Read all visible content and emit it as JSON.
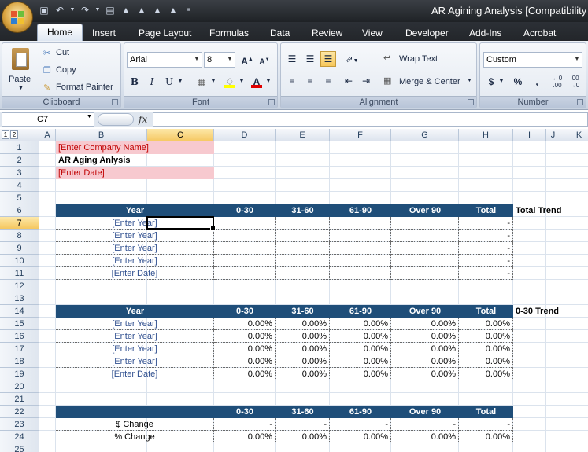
{
  "window": {
    "title": "AR Agining Analysis  [Compatibility"
  },
  "ribbon_tabs": [
    "Home",
    "Insert",
    "Page Layout",
    "Formulas",
    "Data",
    "Review",
    "View",
    "Developer",
    "Add-Ins",
    "Acrobat"
  ],
  "clipboard": {
    "paste": "Paste",
    "cut": "Cut",
    "copy": "Copy",
    "format_painter": "Format Painter",
    "label": "Clipboard"
  },
  "font": {
    "name": "Arial",
    "size": "8",
    "label": "Font",
    "bold": "B",
    "italic": "I",
    "underline": "U"
  },
  "alignment": {
    "wrap": "Wrap Text",
    "merge": "Merge & Center",
    "label": "Alignment"
  },
  "number": {
    "format": "Custom",
    "currency": "$",
    "percent": "%",
    "comma": ",",
    "label": "Number"
  },
  "formula_bar": {
    "name_box": "C7",
    "fx": "fx",
    "value": ""
  },
  "outline_levels": [
    "1",
    "2"
  ],
  "columns": [
    "A",
    "B",
    "C",
    "D",
    "E",
    "F",
    "G",
    "H",
    "I",
    "J",
    "K"
  ],
  "rows": [
    "1",
    "2",
    "3",
    "4",
    "5",
    "6",
    "7",
    "8",
    "9",
    "10",
    "11",
    "12",
    "13",
    "14",
    "15",
    "16",
    "17",
    "18",
    "19",
    "20",
    "21",
    "22",
    "23",
    "24",
    "25"
  ],
  "sheet": {
    "company": "[Enter Company Name]",
    "report_title": "AR Aging Anlysis",
    "date": "[Enter Date]",
    "total_trend": "Total Trend",
    "trend_0_30": "0-30 Trend",
    "table1": {
      "headers": [
        "Year",
        "0-30",
        "31-60",
        "61-90",
        "Over 90",
        "Total"
      ],
      "rows": [
        [
          "[Enter Year]",
          "",
          "",
          "",
          "",
          "-"
        ],
        [
          "[Enter Year]",
          "",
          "",
          "",
          "",
          "-"
        ],
        [
          "[Enter Year]",
          "",
          "",
          "",
          "",
          "-"
        ],
        [
          "[Enter Year]",
          "",
          "",
          "",
          "",
          "-"
        ],
        [
          "[Enter Date]",
          "",
          "",
          "",
          "",
          "-"
        ]
      ]
    },
    "table2": {
      "headers": [
        "Year",
        "0-30",
        "31-60",
        "61-90",
        "Over 90",
        "Total"
      ],
      "rows": [
        [
          "[Enter Year]",
          "0.00%",
          "0.00%",
          "0.00%",
          "0.00%",
          "0.00%"
        ],
        [
          "[Enter Year]",
          "0.00%",
          "0.00%",
          "0.00%",
          "0.00%",
          "0.00%"
        ],
        [
          "[Enter Year]",
          "0.00%",
          "0.00%",
          "0.00%",
          "0.00%",
          "0.00%"
        ],
        [
          "[Enter Year]",
          "0.00%",
          "0.00%",
          "0.00%",
          "0.00%",
          "0.00%"
        ],
        [
          "[Enter Date]",
          "0.00%",
          "0.00%",
          "0.00%",
          "0.00%",
          "0.00%"
        ]
      ]
    },
    "table3": {
      "headers": [
        "",
        "0-30",
        "31-60",
        "61-90",
        "Over 90",
        "Total"
      ],
      "rows": [
        [
          "$ Change",
          "-",
          "-",
          "-",
          "-",
          "-"
        ],
        [
          "% Change",
          "0.00%",
          "0.00%",
          "0.00%",
          "0.00%",
          "0.00%"
        ]
      ]
    }
  }
}
